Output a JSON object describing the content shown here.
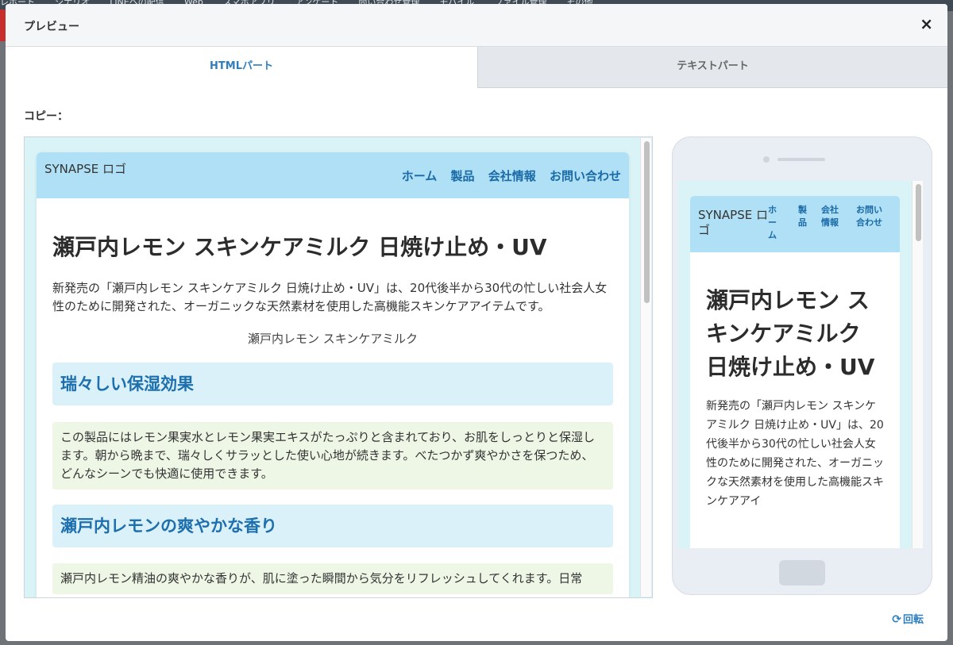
{
  "background_nav": [
    "レポート",
    "シナリオ",
    "LINEへの配信",
    "Web",
    "スマホアプリ",
    "アンケート",
    "問い合わせ管理",
    "モバイル",
    "ファイル管理",
    "その他"
  ],
  "modal": {
    "title": "プレビュー",
    "close_icon": "×"
  },
  "tabs": [
    {
      "label": "HTMLパート",
      "active": true
    },
    {
      "label": "テキストパート",
      "active": false
    }
  ],
  "copy_label": "コピー：",
  "desktop_preview": {
    "logo_alt": "SYNAPSE ロゴ",
    "nav": [
      "ホーム",
      "製品",
      "会社情報",
      "お問い合わせ"
    ],
    "title": "瀬戸内レモン スキンケアミルク 日焼け止め・UV",
    "intro": "新発売の「瀬戸内レモン スキンケアミルク 日焼け止め・UV」は、20代後半から30代の忙しい社会人女性のために開発された、オーガニックな天然素材を使用した高機能スキンケアアイテムです。",
    "image_alt": "瀬戸内レモン スキンケアミルク",
    "sections": [
      {
        "heading": "瑞々しい保湿効果",
        "text": "この製品にはレモン果実水とレモン果実エキスがたっぷりと含まれており、お肌をしっとりと保湿します。朝から晩まで、瑞々しくサラッとした使い心地が続きます。べたつかず爽やかさを保つため、どんなシーンでも快適に使用できます。"
      },
      {
        "heading": "瀬戸内レモンの爽やかな香り",
        "text": "瀬戸内レモン精油の爽やかな香りが、肌に塗った瞬間から気分をリフレッシュしてくれます。日常"
      }
    ]
  },
  "mobile_preview": {
    "logo_alt": "SYNAPSE ロゴ",
    "nav": [
      "ホーム",
      "製品",
      "会社情報",
      "お問い合わせ"
    ],
    "title": "瀬戸内レモン スキンケアミルク 日焼け止め・UV",
    "intro": "新発売の「瀬戸内レモン スキンケアミルク 日焼け止め・UV」は、20代後半から30代の忙しい社会人女性のために開発された、オーガニックな天然素材を使用した高機能スキンケアアイ"
  },
  "rotate": {
    "icon": "⟳",
    "label": "回転"
  },
  "colors": {
    "accent": "#2f7fc0",
    "header_bg": "#afe0f5",
    "heading_bg": "#daf1fa",
    "paragraph_bg": "#eef7e6",
    "frame_bg": "#d9f3f6"
  }
}
